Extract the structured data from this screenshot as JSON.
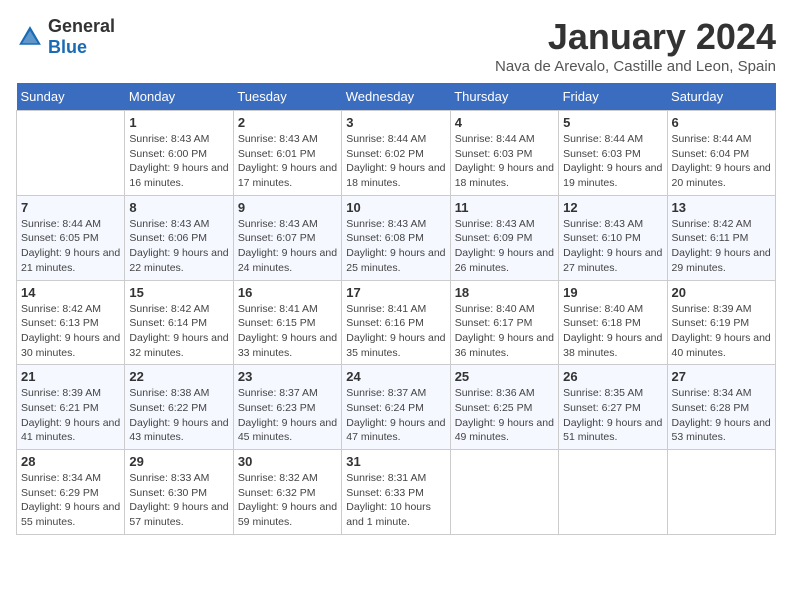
{
  "header": {
    "logo_general": "General",
    "logo_blue": "Blue",
    "title": "January 2024",
    "subtitle": "Nava de Arevalo, Castille and Leon, Spain"
  },
  "weekdays": [
    "Sunday",
    "Monday",
    "Tuesday",
    "Wednesday",
    "Thursday",
    "Friday",
    "Saturday"
  ],
  "weeks": [
    [
      {
        "day": "",
        "sunrise": "",
        "sunset": "",
        "daylight": ""
      },
      {
        "day": "1",
        "sunrise": "Sunrise: 8:43 AM",
        "sunset": "Sunset: 6:00 PM",
        "daylight": "Daylight: 9 hours and 16 minutes."
      },
      {
        "day": "2",
        "sunrise": "Sunrise: 8:43 AM",
        "sunset": "Sunset: 6:01 PM",
        "daylight": "Daylight: 9 hours and 17 minutes."
      },
      {
        "day": "3",
        "sunrise": "Sunrise: 8:44 AM",
        "sunset": "Sunset: 6:02 PM",
        "daylight": "Daylight: 9 hours and 18 minutes."
      },
      {
        "day": "4",
        "sunrise": "Sunrise: 8:44 AM",
        "sunset": "Sunset: 6:03 PM",
        "daylight": "Daylight: 9 hours and 18 minutes."
      },
      {
        "day": "5",
        "sunrise": "Sunrise: 8:44 AM",
        "sunset": "Sunset: 6:03 PM",
        "daylight": "Daylight: 9 hours and 19 minutes."
      },
      {
        "day": "6",
        "sunrise": "Sunrise: 8:44 AM",
        "sunset": "Sunset: 6:04 PM",
        "daylight": "Daylight: 9 hours and 20 minutes."
      }
    ],
    [
      {
        "day": "7",
        "sunrise": "Sunrise: 8:44 AM",
        "sunset": "Sunset: 6:05 PM",
        "daylight": "Daylight: 9 hours and 21 minutes."
      },
      {
        "day": "8",
        "sunrise": "Sunrise: 8:43 AM",
        "sunset": "Sunset: 6:06 PM",
        "daylight": "Daylight: 9 hours and 22 minutes."
      },
      {
        "day": "9",
        "sunrise": "Sunrise: 8:43 AM",
        "sunset": "Sunset: 6:07 PM",
        "daylight": "Daylight: 9 hours and 24 minutes."
      },
      {
        "day": "10",
        "sunrise": "Sunrise: 8:43 AM",
        "sunset": "Sunset: 6:08 PM",
        "daylight": "Daylight: 9 hours and 25 minutes."
      },
      {
        "day": "11",
        "sunrise": "Sunrise: 8:43 AM",
        "sunset": "Sunset: 6:09 PM",
        "daylight": "Daylight: 9 hours and 26 minutes."
      },
      {
        "day": "12",
        "sunrise": "Sunrise: 8:43 AM",
        "sunset": "Sunset: 6:10 PM",
        "daylight": "Daylight: 9 hours and 27 minutes."
      },
      {
        "day": "13",
        "sunrise": "Sunrise: 8:42 AM",
        "sunset": "Sunset: 6:11 PM",
        "daylight": "Daylight: 9 hours and 29 minutes."
      }
    ],
    [
      {
        "day": "14",
        "sunrise": "Sunrise: 8:42 AM",
        "sunset": "Sunset: 6:13 PM",
        "daylight": "Daylight: 9 hours and 30 minutes."
      },
      {
        "day": "15",
        "sunrise": "Sunrise: 8:42 AM",
        "sunset": "Sunset: 6:14 PM",
        "daylight": "Daylight: 9 hours and 32 minutes."
      },
      {
        "day": "16",
        "sunrise": "Sunrise: 8:41 AM",
        "sunset": "Sunset: 6:15 PM",
        "daylight": "Daylight: 9 hours and 33 minutes."
      },
      {
        "day": "17",
        "sunrise": "Sunrise: 8:41 AM",
        "sunset": "Sunset: 6:16 PM",
        "daylight": "Daylight: 9 hours and 35 minutes."
      },
      {
        "day": "18",
        "sunrise": "Sunrise: 8:40 AM",
        "sunset": "Sunset: 6:17 PM",
        "daylight": "Daylight: 9 hours and 36 minutes."
      },
      {
        "day": "19",
        "sunrise": "Sunrise: 8:40 AM",
        "sunset": "Sunset: 6:18 PM",
        "daylight": "Daylight: 9 hours and 38 minutes."
      },
      {
        "day": "20",
        "sunrise": "Sunrise: 8:39 AM",
        "sunset": "Sunset: 6:19 PM",
        "daylight": "Daylight: 9 hours and 40 minutes."
      }
    ],
    [
      {
        "day": "21",
        "sunrise": "Sunrise: 8:39 AM",
        "sunset": "Sunset: 6:21 PM",
        "daylight": "Daylight: 9 hours and 41 minutes."
      },
      {
        "day": "22",
        "sunrise": "Sunrise: 8:38 AM",
        "sunset": "Sunset: 6:22 PM",
        "daylight": "Daylight: 9 hours and 43 minutes."
      },
      {
        "day": "23",
        "sunrise": "Sunrise: 8:37 AM",
        "sunset": "Sunset: 6:23 PM",
        "daylight": "Daylight: 9 hours and 45 minutes."
      },
      {
        "day": "24",
        "sunrise": "Sunrise: 8:37 AM",
        "sunset": "Sunset: 6:24 PM",
        "daylight": "Daylight: 9 hours and 47 minutes."
      },
      {
        "day": "25",
        "sunrise": "Sunrise: 8:36 AM",
        "sunset": "Sunset: 6:25 PM",
        "daylight": "Daylight: 9 hours and 49 minutes."
      },
      {
        "day": "26",
        "sunrise": "Sunrise: 8:35 AM",
        "sunset": "Sunset: 6:27 PM",
        "daylight": "Daylight: 9 hours and 51 minutes."
      },
      {
        "day": "27",
        "sunrise": "Sunrise: 8:34 AM",
        "sunset": "Sunset: 6:28 PM",
        "daylight": "Daylight: 9 hours and 53 minutes."
      }
    ],
    [
      {
        "day": "28",
        "sunrise": "Sunrise: 8:34 AM",
        "sunset": "Sunset: 6:29 PM",
        "daylight": "Daylight: 9 hours and 55 minutes."
      },
      {
        "day": "29",
        "sunrise": "Sunrise: 8:33 AM",
        "sunset": "Sunset: 6:30 PM",
        "daylight": "Daylight: 9 hours and 57 minutes."
      },
      {
        "day": "30",
        "sunrise": "Sunrise: 8:32 AM",
        "sunset": "Sunset: 6:32 PM",
        "daylight": "Daylight: 9 hours and 59 minutes."
      },
      {
        "day": "31",
        "sunrise": "Sunrise: 8:31 AM",
        "sunset": "Sunset: 6:33 PM",
        "daylight": "Daylight: 10 hours and 1 minute."
      },
      {
        "day": "",
        "sunrise": "",
        "sunset": "",
        "daylight": ""
      },
      {
        "day": "",
        "sunrise": "",
        "sunset": "",
        "daylight": ""
      },
      {
        "day": "",
        "sunrise": "",
        "sunset": "",
        "daylight": ""
      }
    ]
  ]
}
